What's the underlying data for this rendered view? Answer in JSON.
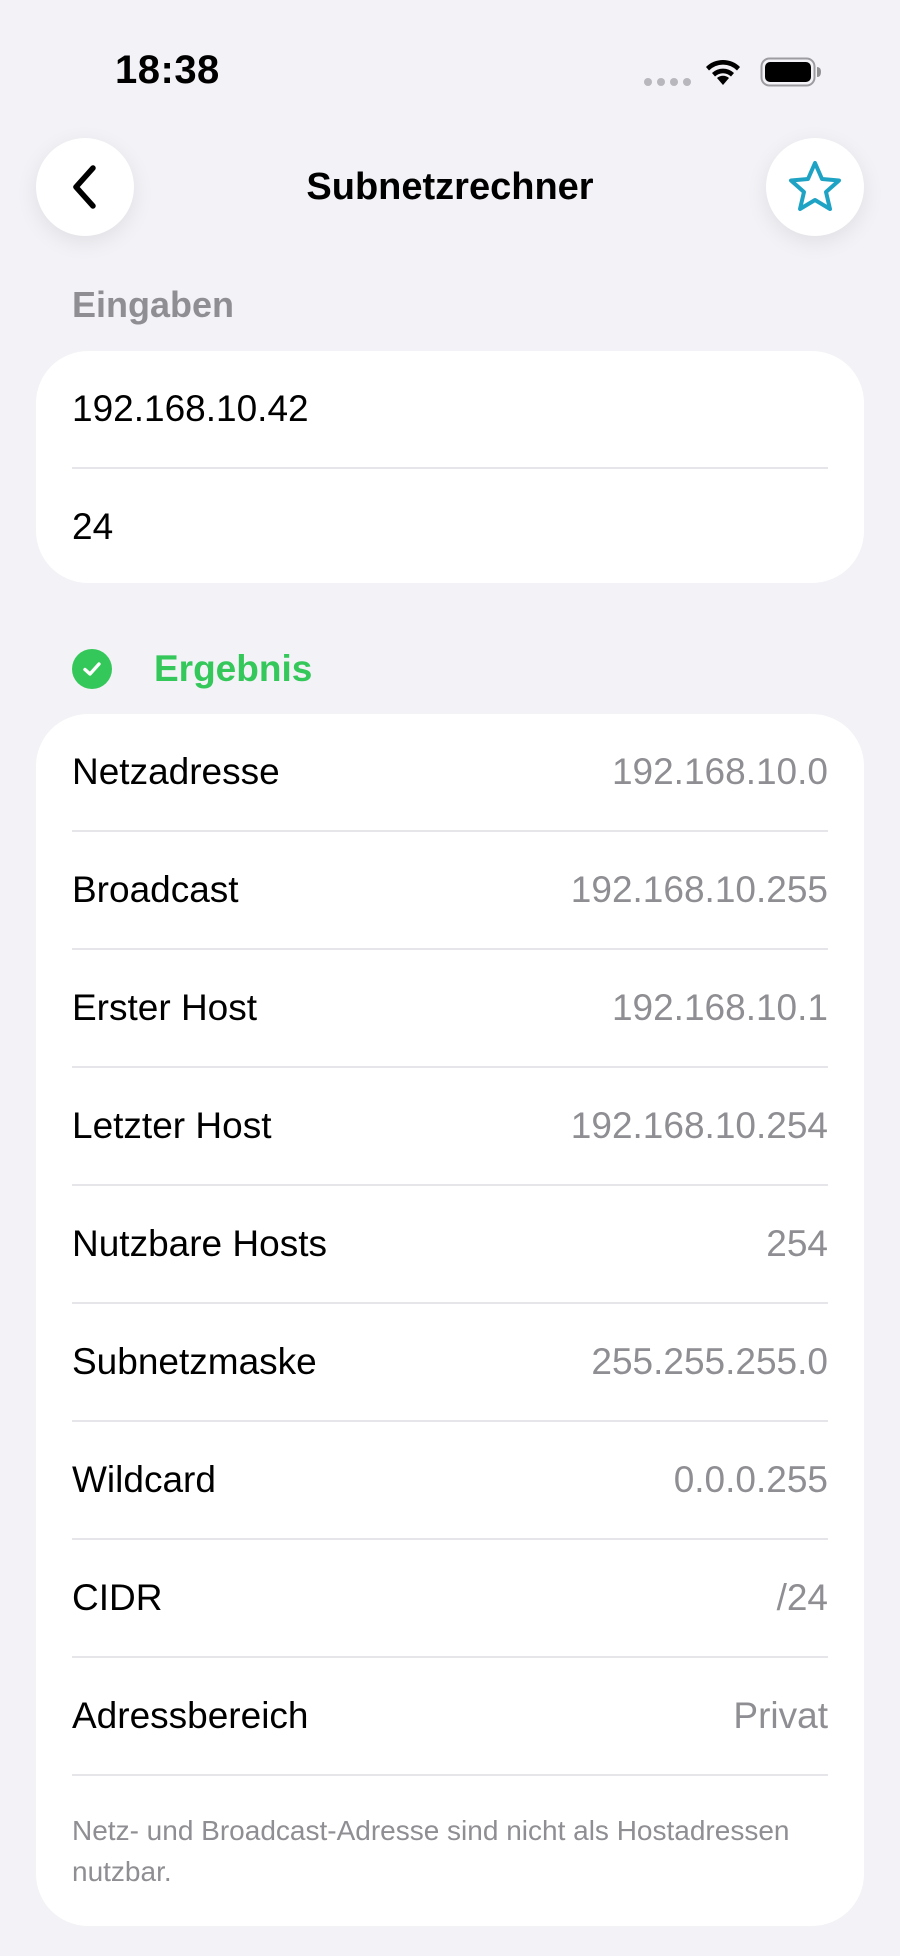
{
  "status": {
    "time": "18:38"
  },
  "nav": {
    "title": "Subnetzrechner",
    "back_icon": "chevron-left-icon",
    "favorite_icon": "star-icon",
    "accent": "#1fa3c4"
  },
  "inputs": {
    "section_label": "Eingaben",
    "ip_value": "192.168.10.42",
    "prefix_value": "24"
  },
  "result": {
    "section_label": "Ergebnis",
    "status_color": "#34c759",
    "rows": [
      {
        "label": "Netzadresse",
        "value": "192.168.10.0"
      },
      {
        "label": "Broadcast",
        "value": "192.168.10.255"
      },
      {
        "label": "Erster Host",
        "value": "192.168.10.1"
      },
      {
        "label": "Letzter Host",
        "value": "192.168.10.254"
      },
      {
        "label": "Nutzbare Hosts",
        "value": "254"
      },
      {
        "label": "Subnetzmaske",
        "value": "255.255.255.0"
      },
      {
        "label": "Wildcard",
        "value": "0.0.0.255"
      },
      {
        "label": "CIDR",
        "value": "/24"
      },
      {
        "label": "Adressbereich",
        "value": "Privat"
      }
    ],
    "footnote": "Netz- und Broadcast-Adresse sind nicht als Hostadressen nutzbar."
  }
}
